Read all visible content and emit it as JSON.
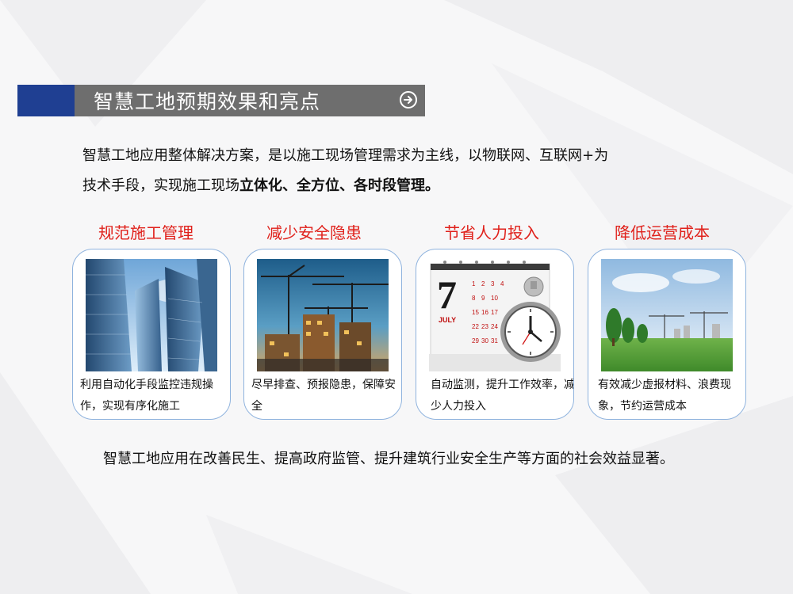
{
  "header": {
    "title": "智慧工地预期效果和亮点"
  },
  "intro": {
    "line1": "智慧工地应用整体解决方案，是以施工现场管理需求为主线，以物联网、互联网+为",
    "line2_prefix": "技术手段，实现施工现场",
    "line2_bold": "立体化、全方位、各时段管理。"
  },
  "features": [
    {
      "heading": "规范施工管理",
      "caption": "利用自动化手段监控违规操作，实现有序化施工"
    },
    {
      "heading": "减少安全隐患",
      "caption": "尽早排查、预报隐患，保障安全"
    },
    {
      "heading": "节省人力投入",
      "caption": "自动监测，提升工作效率，减少人力投入"
    },
    {
      "heading": "降低运营成本",
      "caption": "有效减少虚报材料、浪费现象，节约运营成本"
    }
  ],
  "calendar": {
    "day": "7",
    "month": "JULY"
  },
  "closing": "智慧工地应用在改善民生、提高政府监管、提升建筑行业安全生产等方面的社会效益显著。",
  "colors": {
    "accent_blue": "#1f3f92",
    "header_gray": "#6e6e6e",
    "heading_red": "#e0211b",
    "card_border": "#8fb3de"
  }
}
